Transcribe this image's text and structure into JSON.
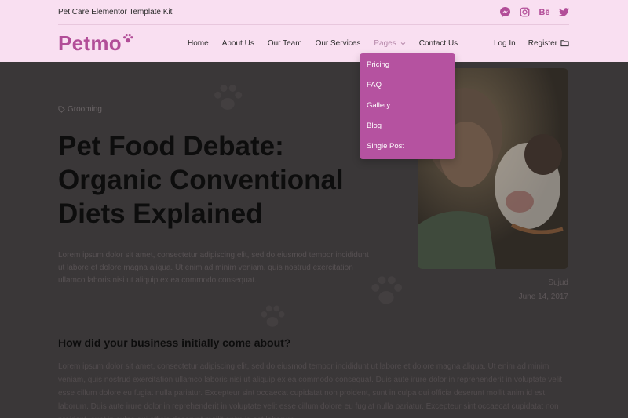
{
  "topbar": {
    "text": "Pet Care Elementor Template Kit",
    "socials": [
      {
        "icon": "messenger-icon"
      },
      {
        "icon": "instagram-icon"
      },
      {
        "icon": "behance-icon",
        "glyph": "Bē"
      },
      {
        "icon": "twitter-icon"
      }
    ]
  },
  "logo": {
    "text": "Petmo",
    "color": "#b24d98"
  },
  "nav": {
    "items": [
      "Home",
      "About Us",
      "Our Team",
      "Our Services",
      "Pages",
      "Contact Us"
    ],
    "active": "Pages",
    "login": "Log In",
    "register": "Register"
  },
  "dropdown": {
    "items": [
      "Pricing",
      "FAQ",
      "Gallery",
      "Blog",
      "Single Post"
    ]
  },
  "post": {
    "category": "Grooming",
    "title_lines": [
      "Pet Food Debate:",
      "Organic Conventional",
      "Diets Explained"
    ],
    "intro": "Lorem ipsum dolor sit amet, consectetur adipiscing elit, sed do eiusmod tempor incididunt ut labore et dolore magna aliqua. Ut enim ad minim veniam, quis nostrud exercitation ullamco laboris nisi ut aliquip ex ea commodo consequat.",
    "author": "Sujud",
    "date": "June 14, 2017",
    "subheading": "How did your business initially come about?",
    "body": "Lorem ipsum dolor sit amet, consectetur adipiscing elit, sed do eiusmod tempor incididunt ut labore et dolore magna aliqua. Ut enim ad minim veniam, quis nostrud exercitation ullamco laboris nisi ut aliquip ex ea commodo consequat. Duis aute irure dolor in reprehenderit in voluptate velit esse cillum dolore eu fugiat nulla pariatur. Excepteur sint occaecat cupidatat non proident, sunt in culpa qui officia deserunt mollit anim id est laborum. Duis aute irure dolor in reprehenderit in voluptate velit esse cillum dolore eu fugiat nulla pariatur. Excepteur sint occaecat cupidatat non proident, sunt in culpa qui officia deserunt mollit anim id est laborum."
  },
  "colors": {
    "brand": "#b24d98",
    "header_bg": "#f9dff1",
    "dropdown_bg": "#b552a0",
    "overlay": "#3a3738"
  }
}
